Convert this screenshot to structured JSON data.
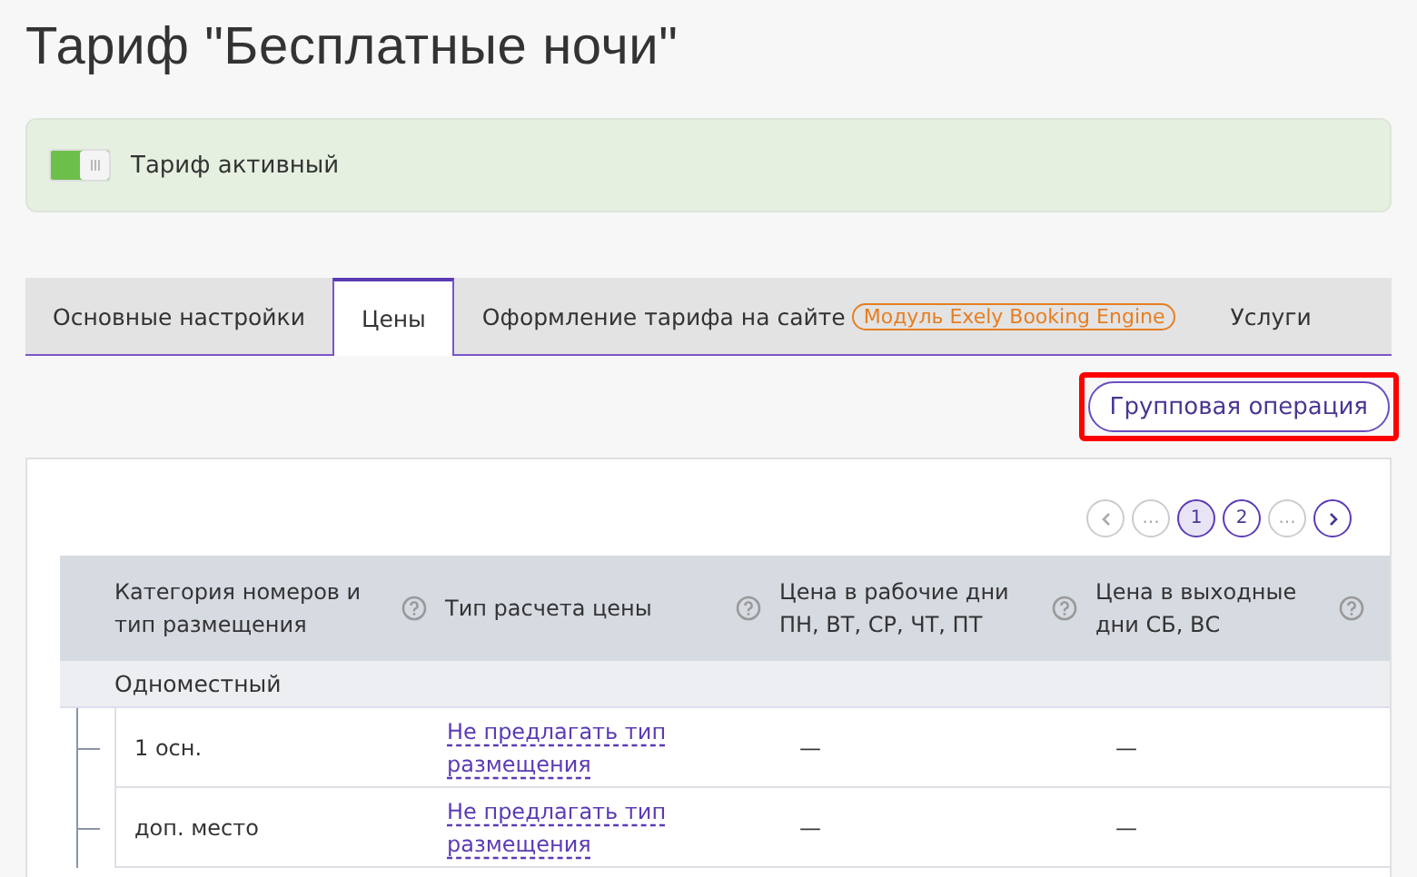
{
  "title": "Тариф \"Бесплатные ночи\"",
  "status": {
    "label": "Тариф активный",
    "on": true
  },
  "tabs": [
    {
      "label": "Основные настройки",
      "selected": false
    },
    {
      "label": "Цены",
      "selected": true
    },
    {
      "label": "Оформление тарифа на сайте",
      "selected": false,
      "badge": "Модуль Exely Booking Engine"
    },
    {
      "label": "Услуги",
      "selected": false
    }
  ],
  "group_action": {
    "label": "Групповая операция",
    "highlighted": true
  },
  "pagination": [
    {
      "kind": "prev",
      "disabled": true,
      "selected": false
    },
    {
      "kind": "ellipsis",
      "label": "...",
      "disabled": true,
      "selected": false
    },
    {
      "kind": "page",
      "label": "1",
      "disabled": false,
      "selected": true
    },
    {
      "kind": "page",
      "label": "2",
      "disabled": false,
      "selected": false
    },
    {
      "kind": "ellipsis",
      "label": "...",
      "disabled": true,
      "selected": false
    },
    {
      "kind": "next",
      "disabled": false,
      "selected": false
    }
  ],
  "table": {
    "columns": [
      "Категория номеров и тип размещения",
      "Тип расчета цены",
      "Цена в рабочие дни ПН, ВТ, СР, ЧТ, ПТ",
      "Цена в выходные дни СБ, ВС"
    ],
    "groups": [
      {
        "name": "Одноместный",
        "rows": [
          {
            "placement": "1 осн.",
            "price_type": "Не предлагать тип размещения",
            "weekday": "—",
            "weekend": "—"
          },
          {
            "placement": "доп. место",
            "price_type": "Не предлагать тип размещения",
            "weekday": "—",
            "weekend": "—"
          }
        ]
      }
    ]
  }
}
